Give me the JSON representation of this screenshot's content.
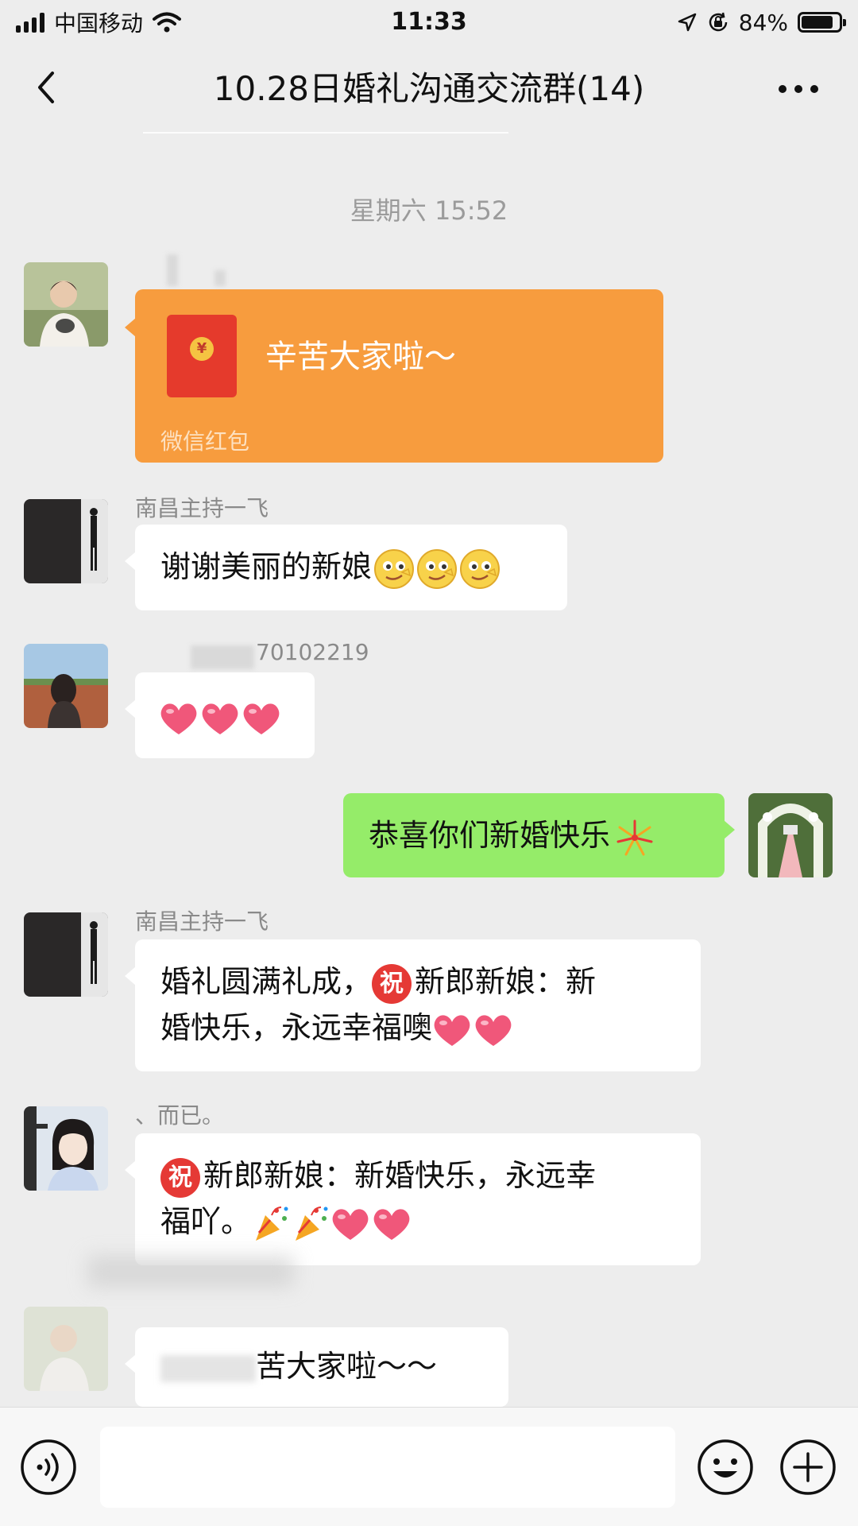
{
  "status_bar": {
    "carrier": "中国移动",
    "time": "11:33",
    "battery_percent_label": "84%",
    "battery_level": 0.84,
    "icons": [
      "signal-icon",
      "wifi-icon",
      "location-icon",
      "rotation-lock-icon",
      "battery-icon"
    ]
  },
  "header": {
    "title": "10.28日婚礼沟通交流群(14)",
    "back_icon": "chevron-left-icon",
    "more_icon": "more-dots-icon"
  },
  "chat": {
    "time_divider": "星期六 15:52",
    "messages": [
      {
        "type": "red_packet",
        "sender": "",
        "text": "辛苦大家啦～",
        "label": "微信红包"
      },
      {
        "type": "text",
        "sender": "南昌主持一飞",
        "text": "谢谢美丽的新娘",
        "emoji": [
          "smirk-face-icon",
          "smirk-face-icon",
          "smirk-face-icon"
        ]
      },
      {
        "type": "text",
        "sender": "70102219",
        "text": "",
        "emoji": [
          "heart-icon",
          "heart-icon",
          "heart-icon"
        ]
      },
      {
        "type": "text",
        "outgoing": true,
        "text": "恭喜你们新婚快乐",
        "emoji": [
          "fireworks-icon"
        ]
      },
      {
        "type": "text",
        "sender": "南昌主持一飞",
        "line1_a": "婚礼圆满礼成，",
        "line1_b": "新郎新娘：新",
        "line2": "婚快乐，永远幸福噢",
        "emoji": [
          "zhu-icon",
          "heart-icon",
          "heart-icon"
        ]
      },
      {
        "type": "text",
        "sender": "、而已。",
        "line1": "新郎新娘：新婚快乐，永远幸",
        "line2": "福吖。",
        "emoji": [
          "zhu-icon",
          "party-popper-icon",
          "party-popper-icon",
          "heart-icon",
          "heart-icon"
        ]
      },
      {
        "type": "text",
        "sender": "",
        "text": "苦大家啦～～"
      }
    ],
    "zhu_char": "祝",
    "coin_char": "¥"
  },
  "input_bar": {
    "placeholder": "",
    "icons": [
      "voice-icon",
      "emoji-icon",
      "plus-icon"
    ]
  },
  "colors": {
    "background": "#ededed",
    "bubble_incoming": "#ffffff",
    "bubble_outgoing": "#95ec69",
    "red_packet": "#f79c3e"
  }
}
